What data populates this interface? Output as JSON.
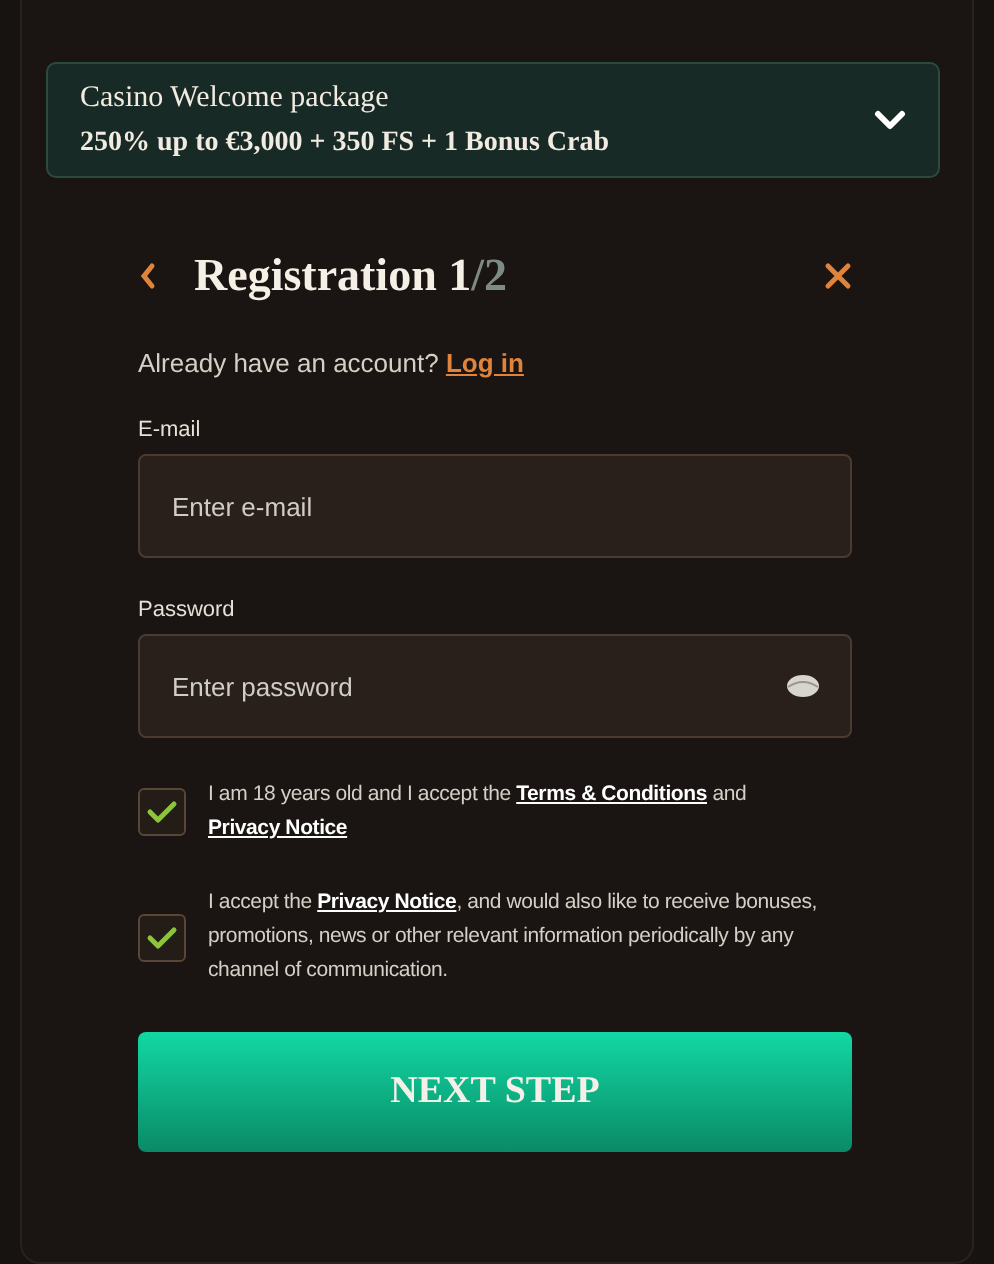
{
  "banner": {
    "title": "Casino Welcome package",
    "offer": "250% up to €3,000 + 350 FS + 1 Bonus Crab",
    "expanded": false
  },
  "header": {
    "title": "Registration 1",
    "title_rest": "/2"
  },
  "login_prompt": {
    "text": "Already have an account?",
    "link": "Log in"
  },
  "fields": [
    {
      "label": "E-mail",
      "placeholder": "Enter e-mail",
      "kind": "email"
    },
    {
      "label": "Password",
      "placeholder": "Enter password",
      "kind": "password"
    }
  ],
  "consents": [
    {
      "checked": true,
      "parts": [
        {
          "kind": "text",
          "text": "I am 18 years old and I accept the "
        },
        {
          "kind": "link",
          "text": "Terms & Conditions"
        },
        {
          "kind": "text",
          "text": " and "
        },
        {
          "kind": "link",
          "text": "Privacy Notice"
        }
      ]
    },
    {
      "checked": true,
      "parts": [
        {
          "kind": "text",
          "text": "I accept the "
        },
        {
          "kind": "link",
          "text": "Privacy Notice"
        },
        {
          "kind": "text",
          "text": ", and would also like to receive bonuses, promotions, news or other relevant information periodically by any channel of communication."
        }
      ]
    }
  ],
  "submit": "NEXT STEP"
}
